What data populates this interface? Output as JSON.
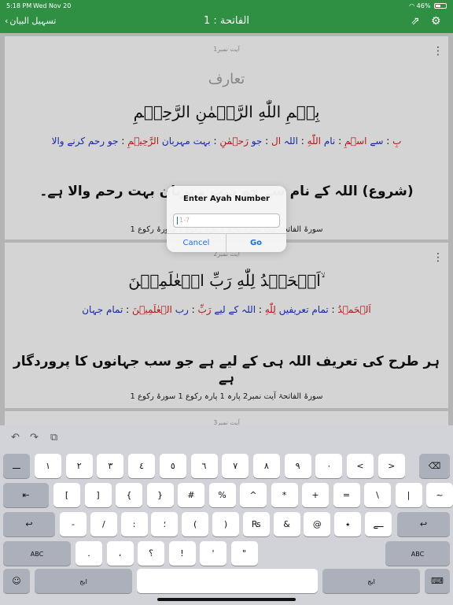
{
  "status": {
    "time": "5:18 PM",
    "date": "Wed Nov 20",
    "battery": "46%",
    "battery_level": 0.46
  },
  "header": {
    "back_label": "تسہیل البیان",
    "title": "الفاتحة : 1"
  },
  "cards": [
    {
      "ayah_no": "آیت نمبر1",
      "intro": "تعارف",
      "arabic": "بِسۡمِ اللّٰهِ الرَّحۡمٰنِ الرَّحِيۡمِ",
      "words": [
        {
          "ar": "بِ",
          "ur": "سے"
        },
        {
          "ar": "اسۡمِ",
          "ur": "نام"
        },
        {
          "ar": "اللّٰهِ",
          "ur": "اللہ"
        },
        {
          "ar": "ال",
          "ur": "جو"
        },
        {
          "ar": "رَحۡمٰنِ",
          "ur": "بہت مہربان"
        },
        {
          "ar": "الرَّحِيۡمِ",
          "ur": "جو رحم کرنے والا"
        }
      ],
      "translation": "(شروع) اللہ کے نام سے جو بہت مہربان بہت رحم والا ہے۔",
      "reference": "سورۃ الفاتحۃ آیت نمبر1  پارہ 1 پارہ رکوع 1 سورۃ رکوع 1"
    },
    {
      "ayah_no": "آیت نمبر2",
      "arabic": "اَلۡحَمۡدُ لِلّٰهِ رَبِّ الۡعٰلَمِيۡنَ ۙ",
      "words": [
        {
          "ar": "اَلۡحَمۡدُ",
          "ur": "تمام تعریفیں"
        },
        {
          "ar": "لِلّٰهِ",
          "ur": "اللہ کے لیے"
        },
        {
          "ar": "رَبِّ",
          "ur": "رب"
        },
        {
          "ar": "الۡعٰلَمِيۡنَ",
          "ur": "تمام جہان"
        }
      ],
      "translation": "ہر طرح کی تعریف اللہ ہی کے لیے ہے جو سب جہانوں کا پروردگار ہے",
      "reference": "سورۃ الفاتحۃ آیت نمبر2  پارہ 1 پارہ رکوع 1 سورۃ رکوع 1"
    },
    {
      "ayah_no": "آیت نمبر3"
    }
  ],
  "dialog": {
    "title": "Enter Ayah Number",
    "placeholder": "1-7",
    "cancel_label": "Cancel",
    "go_label": "Go"
  },
  "keyboard": {
    "toolbar": {
      "undo": "↶",
      "redo": "↷",
      "paste": "⧉"
    },
    "row1": [
      "ـــ",
      "١",
      "٢",
      "٣",
      "٤",
      "٥",
      "٦",
      "٧",
      "٨",
      "٩",
      "٠",
      "<",
      ">",
      "⌫"
    ],
    "row2": [
      "⇤",
      "[",
      "]",
      "{",
      "}",
      "#",
      "%",
      "^",
      "*",
      "+",
      "=",
      "\\",
      "|",
      "~"
    ],
    "row3": [
      "↩",
      "-",
      "/",
      ":",
      "؛",
      "(",
      ")",
      "₨",
      "&",
      "@",
      "٭",
      "ــے",
      "↩"
    ],
    "row4": [
      "ABC",
      ".",
      "،",
      "؟",
      "!",
      "'",
      "\"",
      "ABC"
    ],
    "row5": {
      "emoji": "☺",
      "left_mode": "ابج",
      "space": "",
      "right_mode": "ابج",
      "hide": "⌨"
    }
  }
}
